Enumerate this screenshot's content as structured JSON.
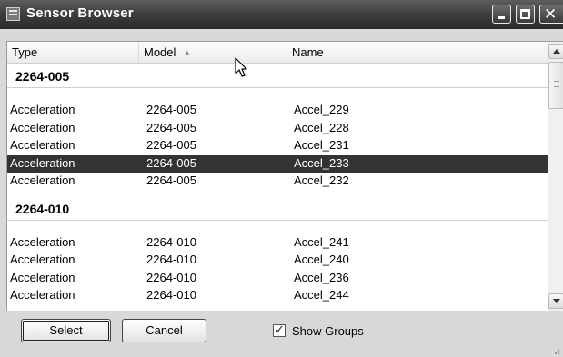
{
  "window": {
    "title": "Sensor Browser"
  },
  "columns": {
    "type": "Type",
    "model": "Model",
    "name": "Name"
  },
  "groups": [
    {
      "title": "2264-005",
      "rows": [
        {
          "type": "Acceleration",
          "model": "2264-005",
          "name": "Accel_229",
          "selected": false
        },
        {
          "type": "Acceleration",
          "model": "2264-005",
          "name": "Accel_228",
          "selected": false
        },
        {
          "type": "Acceleration",
          "model": "2264-005",
          "name": "Accel_231",
          "selected": false
        },
        {
          "type": "Acceleration",
          "model": "2264-005",
          "name": "Accel_233",
          "selected": true
        },
        {
          "type": "Acceleration",
          "model": "2264-005",
          "name": "Accel_232",
          "selected": false
        }
      ]
    },
    {
      "title": "2264-010",
      "rows": [
        {
          "type": "Acceleration",
          "model": "2264-010",
          "name": "Accel_241",
          "selected": false
        },
        {
          "type": "Acceleration",
          "model": "2264-010",
          "name": "Accel_240",
          "selected": false
        },
        {
          "type": "Acceleration",
          "model": "2264-010",
          "name": "Accel_236",
          "selected": false
        },
        {
          "type": "Acceleration",
          "model": "2264-010",
          "name": "Accel_244",
          "selected": false
        }
      ]
    }
  ],
  "buttons": {
    "select": "Select",
    "cancel": "Cancel"
  },
  "show_groups": {
    "label": "Show Groups",
    "checked": true
  },
  "sort": {
    "column": "Model",
    "direction": "ascending"
  },
  "colors": {
    "selection": "#333333",
    "titlebar": "#3f3f3f"
  },
  "icons": [
    "app-icon",
    "minimize-icon",
    "maximize-icon",
    "close-icon",
    "sort-up-icon",
    "scroll-up-icon",
    "scroll-down-icon",
    "mouse-cursor-icon",
    "checkmark-icon",
    "resize-grip-icon"
  ]
}
